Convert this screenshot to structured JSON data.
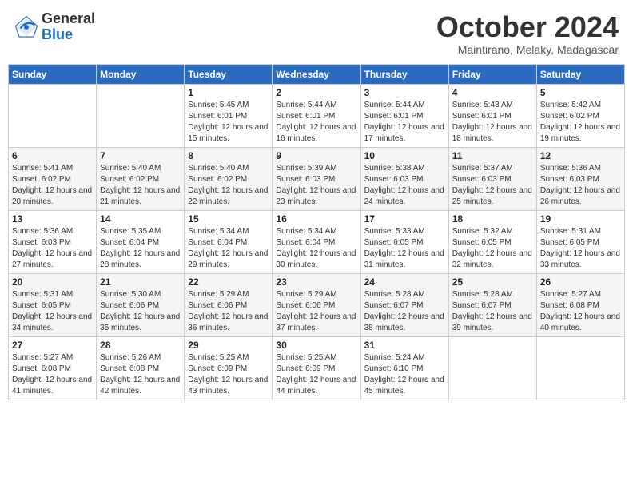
{
  "header": {
    "logo": {
      "general": "General",
      "blue": "Blue"
    },
    "title": "October 2024",
    "location": "Maintirano, Melaky, Madagascar"
  },
  "days_of_week": [
    "Sunday",
    "Monday",
    "Tuesday",
    "Wednesday",
    "Thursday",
    "Friday",
    "Saturday"
  ],
  "weeks": [
    [
      {
        "day": null
      },
      {
        "day": null
      },
      {
        "day": "1",
        "sunrise": "5:45 AM",
        "sunset": "6:01 PM",
        "daylight": "12 hours and 15 minutes."
      },
      {
        "day": "2",
        "sunrise": "5:44 AM",
        "sunset": "6:01 PM",
        "daylight": "12 hours and 16 minutes."
      },
      {
        "day": "3",
        "sunrise": "5:44 AM",
        "sunset": "6:01 PM",
        "daylight": "12 hours and 17 minutes."
      },
      {
        "day": "4",
        "sunrise": "5:43 AM",
        "sunset": "6:01 PM",
        "daylight": "12 hours and 18 minutes."
      },
      {
        "day": "5",
        "sunrise": "5:42 AM",
        "sunset": "6:02 PM",
        "daylight": "12 hours and 19 minutes."
      }
    ],
    [
      {
        "day": "6",
        "sunrise": "5:41 AM",
        "sunset": "6:02 PM",
        "daylight": "12 hours and 20 minutes."
      },
      {
        "day": "7",
        "sunrise": "5:40 AM",
        "sunset": "6:02 PM",
        "daylight": "12 hours and 21 minutes."
      },
      {
        "day": "8",
        "sunrise": "5:40 AM",
        "sunset": "6:02 PM",
        "daylight": "12 hours and 22 minutes."
      },
      {
        "day": "9",
        "sunrise": "5:39 AM",
        "sunset": "6:03 PM",
        "daylight": "12 hours and 23 minutes."
      },
      {
        "day": "10",
        "sunrise": "5:38 AM",
        "sunset": "6:03 PM",
        "daylight": "12 hours and 24 minutes."
      },
      {
        "day": "11",
        "sunrise": "5:37 AM",
        "sunset": "6:03 PM",
        "daylight": "12 hours and 25 minutes."
      },
      {
        "day": "12",
        "sunrise": "5:36 AM",
        "sunset": "6:03 PM",
        "daylight": "12 hours and 26 minutes."
      }
    ],
    [
      {
        "day": "13",
        "sunrise": "5:36 AM",
        "sunset": "6:03 PM",
        "daylight": "12 hours and 27 minutes."
      },
      {
        "day": "14",
        "sunrise": "5:35 AM",
        "sunset": "6:04 PM",
        "daylight": "12 hours and 28 minutes."
      },
      {
        "day": "15",
        "sunrise": "5:34 AM",
        "sunset": "6:04 PM",
        "daylight": "12 hours and 29 minutes."
      },
      {
        "day": "16",
        "sunrise": "5:34 AM",
        "sunset": "6:04 PM",
        "daylight": "12 hours and 30 minutes."
      },
      {
        "day": "17",
        "sunrise": "5:33 AM",
        "sunset": "6:05 PM",
        "daylight": "12 hours and 31 minutes."
      },
      {
        "day": "18",
        "sunrise": "5:32 AM",
        "sunset": "6:05 PM",
        "daylight": "12 hours and 32 minutes."
      },
      {
        "day": "19",
        "sunrise": "5:31 AM",
        "sunset": "6:05 PM",
        "daylight": "12 hours and 33 minutes."
      }
    ],
    [
      {
        "day": "20",
        "sunrise": "5:31 AM",
        "sunset": "6:05 PM",
        "daylight": "12 hours and 34 minutes."
      },
      {
        "day": "21",
        "sunrise": "5:30 AM",
        "sunset": "6:06 PM",
        "daylight": "12 hours and 35 minutes."
      },
      {
        "day": "22",
        "sunrise": "5:29 AM",
        "sunset": "6:06 PM",
        "daylight": "12 hours and 36 minutes."
      },
      {
        "day": "23",
        "sunrise": "5:29 AM",
        "sunset": "6:06 PM",
        "daylight": "12 hours and 37 minutes."
      },
      {
        "day": "24",
        "sunrise": "5:28 AM",
        "sunset": "6:07 PM",
        "daylight": "12 hours and 38 minutes."
      },
      {
        "day": "25",
        "sunrise": "5:28 AM",
        "sunset": "6:07 PM",
        "daylight": "12 hours and 39 minutes."
      },
      {
        "day": "26",
        "sunrise": "5:27 AM",
        "sunset": "6:08 PM",
        "daylight": "12 hours and 40 minutes."
      }
    ],
    [
      {
        "day": "27",
        "sunrise": "5:27 AM",
        "sunset": "6:08 PM",
        "daylight": "12 hours and 41 minutes."
      },
      {
        "day": "28",
        "sunrise": "5:26 AM",
        "sunset": "6:08 PM",
        "daylight": "12 hours and 42 minutes."
      },
      {
        "day": "29",
        "sunrise": "5:25 AM",
        "sunset": "6:09 PM",
        "daylight": "12 hours and 43 minutes."
      },
      {
        "day": "30",
        "sunrise": "5:25 AM",
        "sunset": "6:09 PM",
        "daylight": "12 hours and 44 minutes."
      },
      {
        "day": "31",
        "sunrise": "5:24 AM",
        "sunset": "6:10 PM",
        "daylight": "12 hours and 45 minutes."
      },
      {
        "day": null
      },
      {
        "day": null
      }
    ]
  ],
  "labels": {
    "sunrise": "Sunrise:",
    "sunset": "Sunset:",
    "daylight": "Daylight:"
  }
}
